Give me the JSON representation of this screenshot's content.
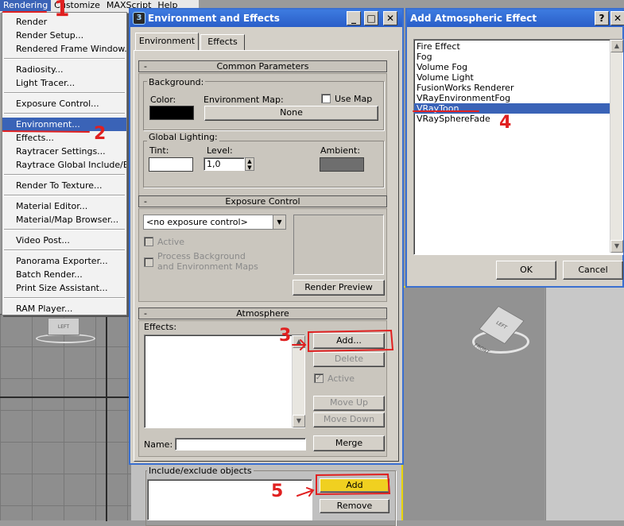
{
  "menubar": {
    "items": [
      "Rendering",
      "Customize",
      "MAXScript",
      "Help"
    ]
  },
  "rendering_menu": {
    "items": [
      "Render",
      "Render Setup...",
      "Rendered Frame Window...",
      "Radiosity...",
      "Light Tracer...",
      "Exposure Control...",
      "Environment...",
      "Effects...",
      "Raytracer Settings...",
      "Raytrace Global Include/Excl",
      "Render To Texture...",
      "Material Editor...",
      "Material/Map Browser...",
      "Video Post...",
      "Panorama Exporter...",
      "Batch Render...",
      "Print Size Assistant...",
      "RAM Player..."
    ],
    "selected": "Environment..."
  },
  "env_window": {
    "title": "Environment and Effects",
    "tabs": [
      "Environment",
      "Effects"
    ],
    "common": {
      "title": "Common Parameters",
      "background_label": "Background:",
      "color_label": "Color:",
      "env_map_label": "Environment Map:",
      "use_map_label": "Use Map",
      "none_button": "None",
      "global_lighting_label": "Global Lighting:",
      "tint_label": "Tint:",
      "level_label": "Level:",
      "level_value": "1,0",
      "ambient_label": "Ambient:",
      "colors": {
        "background": "#000000",
        "tint": "#ffffff",
        "ambient": "#6e6e6e"
      }
    },
    "exposure": {
      "title": "Exposure Control",
      "select_value": "<no exposure control>",
      "active_label": "Active",
      "process_bg_line1": "Process Background",
      "process_bg_line2": "and Environment Maps",
      "render_preview_button": "Render Preview"
    },
    "atmosphere": {
      "title": "Atmosphere",
      "effects_label": "Effects:",
      "add_button": "Add...",
      "delete_button": "Delete",
      "active_label": "Active",
      "move_up_button": "Move Up",
      "move_down_button": "Move Down",
      "name_label": "Name:",
      "merge_button": "Merge"
    }
  },
  "include_exclude": {
    "label": "Include/exclude objects",
    "add_button": "Add",
    "remove_button": "Remove"
  },
  "atmos_dialog": {
    "title": "Add Atmospheric Effect",
    "help_button": "?",
    "close_button": "✕",
    "items": [
      "Fire Effect",
      "Fog",
      "Volume Fog",
      "Volume Light",
      "FusionWorks Renderer",
      "VRayEnvironmentFog",
      "VRayToon",
      "VRaySphereFade"
    ],
    "selected": "VRayToon",
    "ok_button": "OK",
    "cancel_button": "Cancel"
  },
  "viewport": {
    "left_label": "LEFT",
    "cube_label": "LEFT FRONT"
  },
  "annotations": [
    "1",
    "2",
    "3",
    "4",
    "5"
  ]
}
